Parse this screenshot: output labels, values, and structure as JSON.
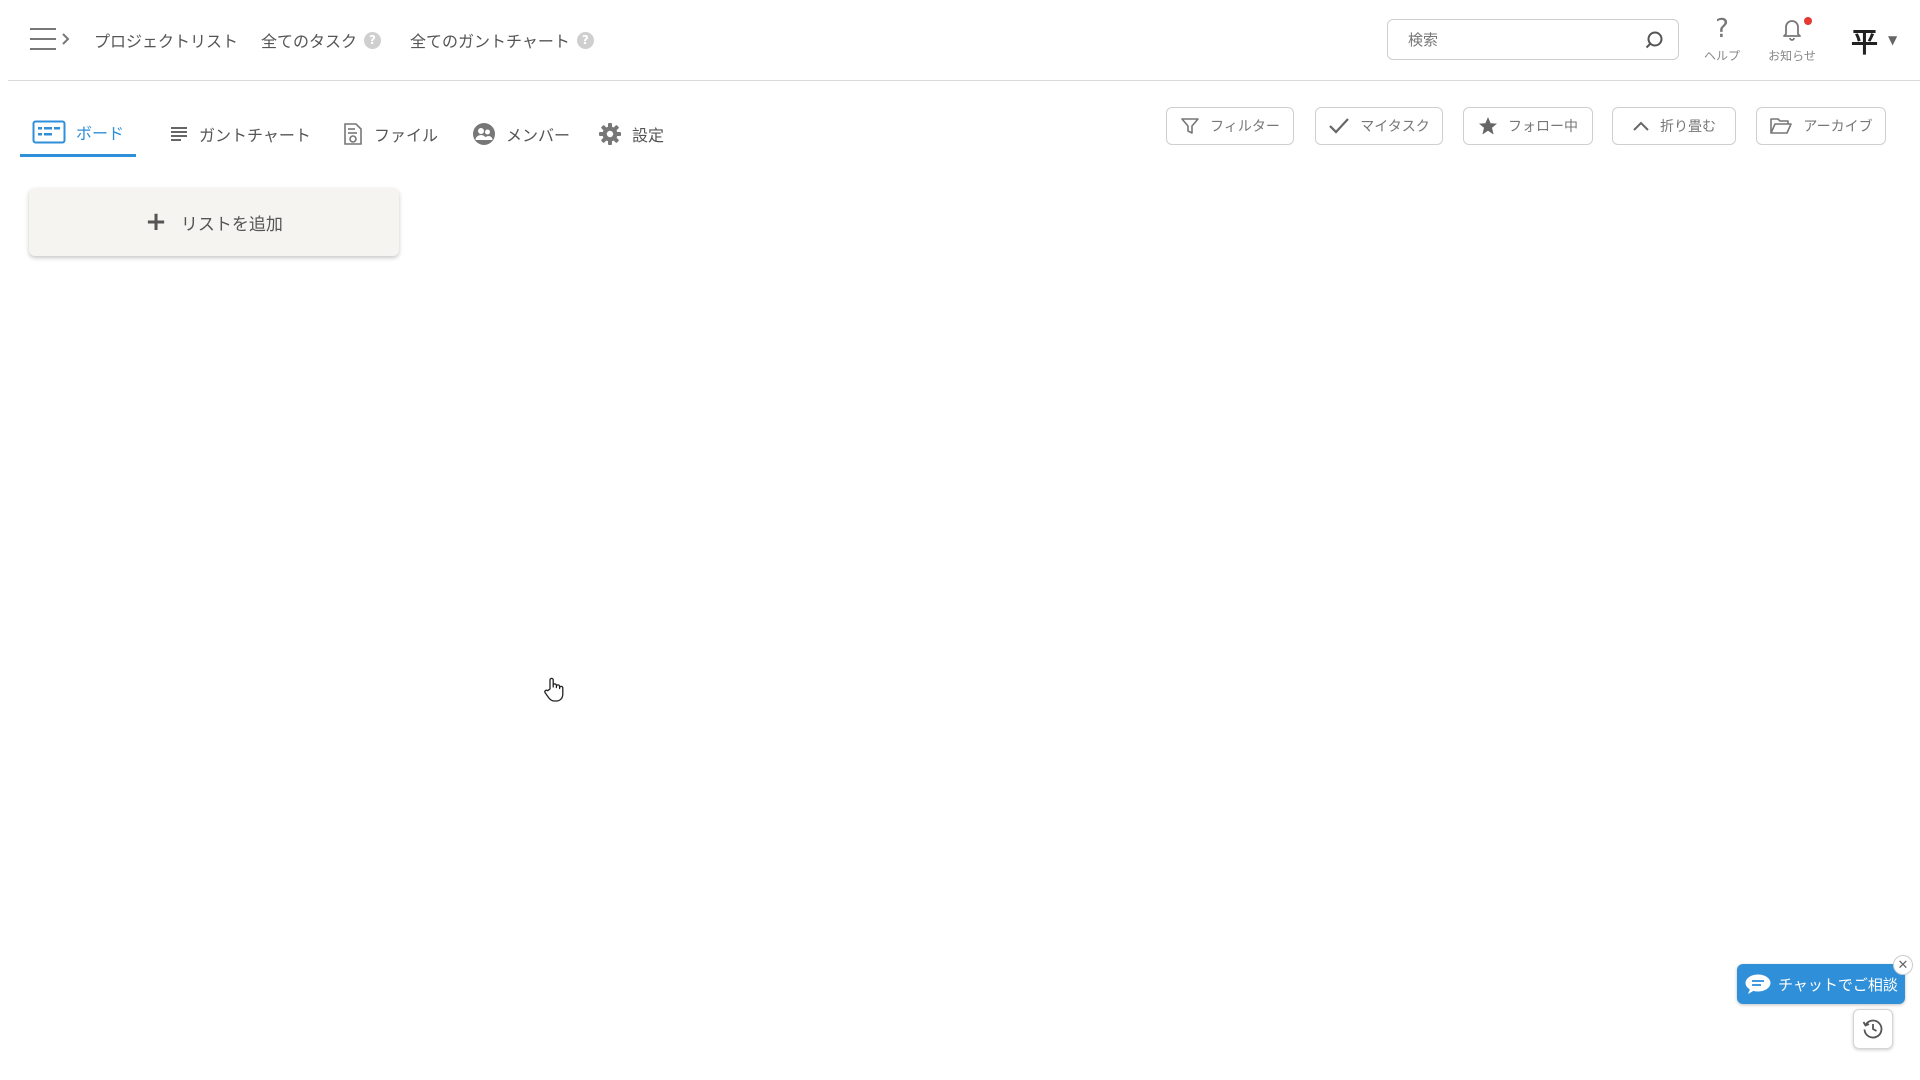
{
  "header": {
    "nav": [
      {
        "label": "プロジェクトリスト",
        "has_help": false
      },
      {
        "label": "全てのタスク",
        "has_help": true
      },
      {
        "label": "全てのガントチャート",
        "has_help": true
      }
    ],
    "help_badge": "?",
    "search_placeholder": "検索",
    "help_label": "ヘルプ",
    "help_glyph": "?",
    "notifications_label": "お知らせ",
    "notifications_unread": true,
    "avatar_initial": "平",
    "avatar_caret": "▼"
  },
  "tabs": [
    {
      "label": "ボード",
      "icon": "board-icon",
      "active": true
    },
    {
      "label": "ガントチャート",
      "icon": "list-icon",
      "active": false
    },
    {
      "label": "ファイル",
      "icon": "file-icon",
      "active": false
    },
    {
      "label": "メンバー",
      "icon": "members-icon",
      "active": false
    },
    {
      "label": "設定",
      "icon": "gear-icon",
      "active": false
    }
  ],
  "toolbar": {
    "filter": "フィルター",
    "my_tasks": "マイタスク",
    "following": "フォロー中",
    "collapse": "折り畳む",
    "archive": "アーカイブ"
  },
  "board": {
    "add_list": "リストを追加",
    "add_glyph": "+"
  },
  "chat": {
    "label": "チャットでご相談",
    "close_glyph": "✕"
  },
  "colors": {
    "accent": "#2f8fd8",
    "notification_dot": "#e53935",
    "add_list_bg": "#f5f4f0"
  }
}
